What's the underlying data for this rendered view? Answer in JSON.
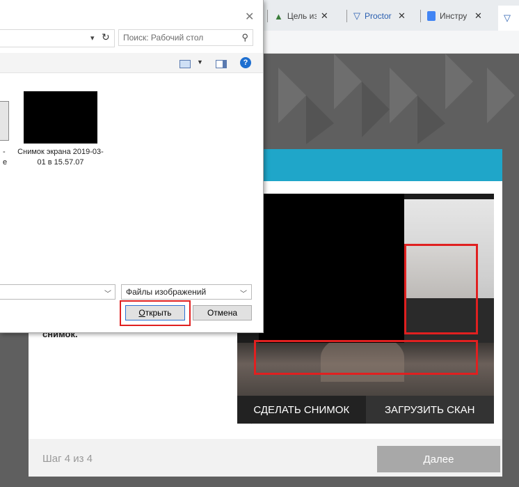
{
  "browser": {
    "tabs": [
      {
        "label": "Цель из",
        "icon": "document-tree-icon"
      },
      {
        "label": "Proctor",
        "icon": "shield-icon"
      },
      {
        "label": "Инстру",
        "icon": "google-docs-icon"
      },
      {
        "label": "",
        "icon": "shield-icon"
      }
    ]
  },
  "dialog": {
    "search_placeholder": "Поиск: Рабочий стол",
    "partial_file_caption_1": "-",
    "partial_file_caption_2": "e",
    "file_caption": "Снимок экрана 2019-03-01 в 15.57.07",
    "filetype_selected": "Файлы изображений",
    "open_label_underlined": "О",
    "open_label_rest": "ткрыть",
    "cancel_label": "Отмена"
  },
  "modal": {
    "instruction_text": "снимок.",
    "snapshot_button": "СДЕЛАТЬ СНИМОК",
    "upload_button": "ЗАГРУЗИТЬ СКАН",
    "step_text": "Шаг 4 из 4",
    "next_button": "Далее"
  },
  "colors": {
    "header_accent": "#1fa6c9",
    "highlight_red": "#e02020",
    "next_disabled": "#a8a8a8"
  }
}
